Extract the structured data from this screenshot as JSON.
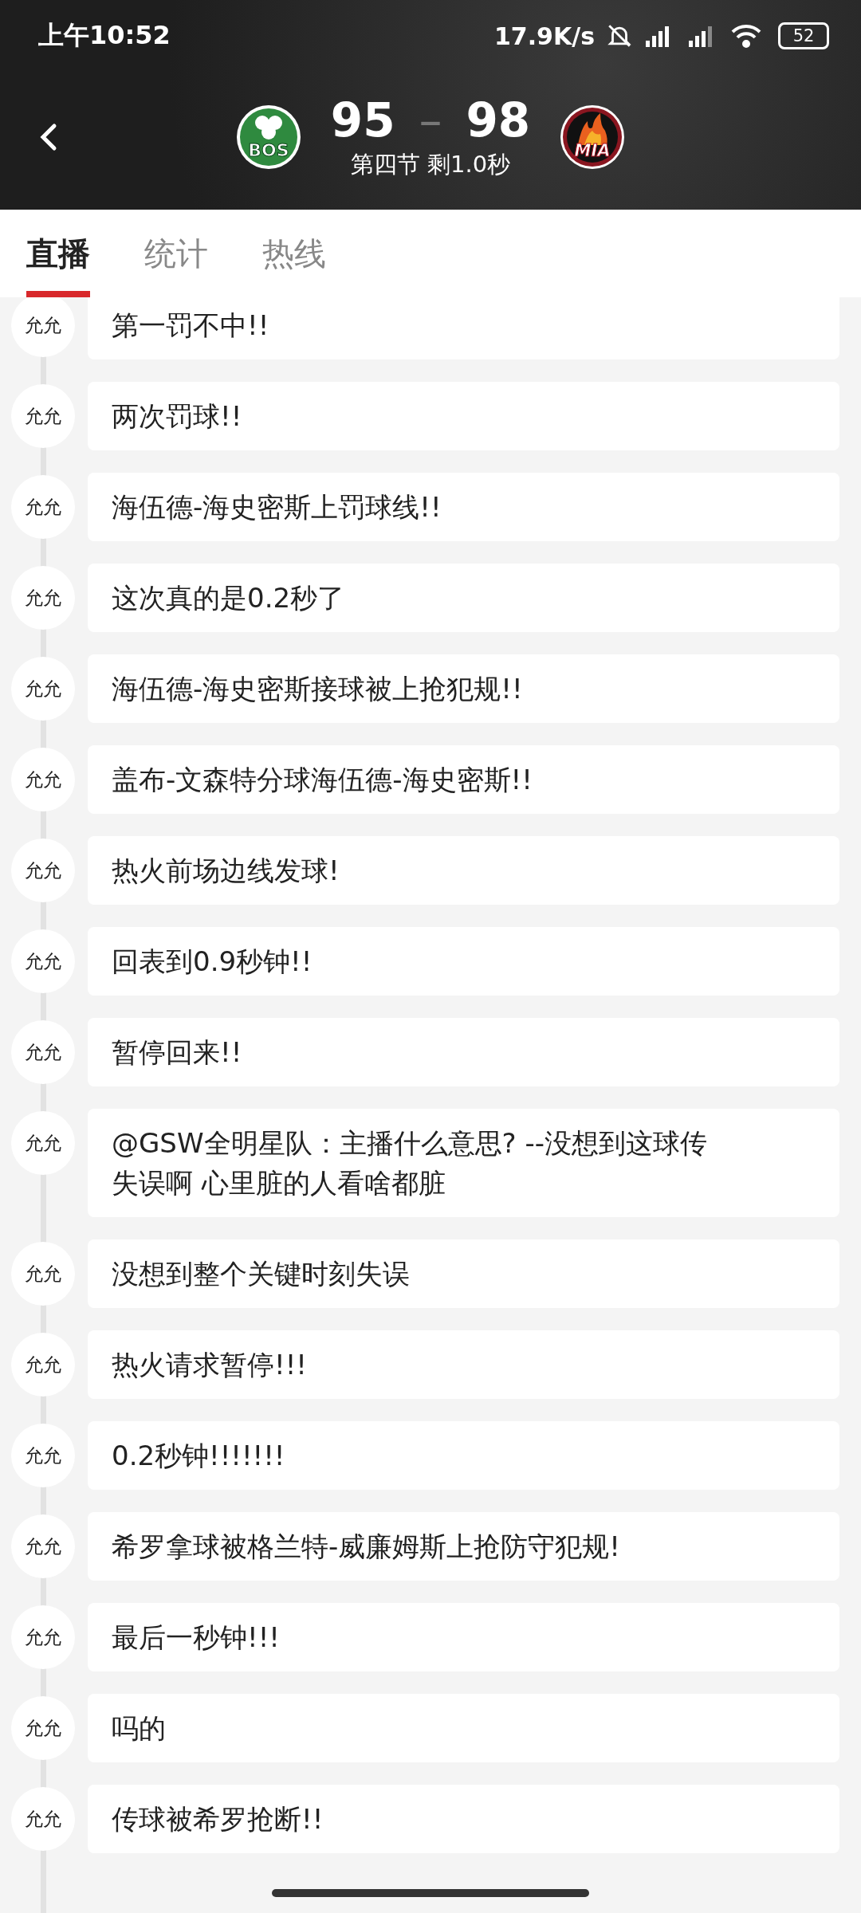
{
  "status_bar": {
    "time": "上午10:52",
    "net_speed": "17.9K/s",
    "battery": "52"
  },
  "header": {
    "home_team": {
      "logo_text": "BOS"
    },
    "home_score": "95",
    "separator": "–",
    "away_score": "98",
    "period": "第四节 剩1.0秒",
    "away_team": {
      "logo_text": "MIA"
    }
  },
  "tabs": [
    {
      "label": "直播",
      "selected": true
    },
    {
      "label": "统计",
      "selected": false
    },
    {
      "label": "热线",
      "selected": false
    }
  ],
  "feed": [
    {
      "author": "允允",
      "text": "第一罚不中!!"
    },
    {
      "author": "允允",
      "text": "两次罚球!!"
    },
    {
      "author": "允允",
      "text": "海伍德-海史密斯上罚球线!!"
    },
    {
      "author": "允允",
      "text": "这次真的是0.2秒了"
    },
    {
      "author": "允允",
      "text": "海伍德-海史密斯接球被上抢犯规!!"
    },
    {
      "author": "允允",
      "text": "盖布-文森特分球海伍德-海史密斯!!"
    },
    {
      "author": "允允",
      "text": "热火前场边线发球!"
    },
    {
      "author": "允允",
      "text": "回表到0.9秒钟!!"
    },
    {
      "author": "允允",
      "text": "暂停回来!!"
    },
    {
      "author": "允允",
      "text": "@GSW全明星队：主播什么意思? --没想到这球传失误啊 心里脏的人看啥都脏"
    },
    {
      "author": "允允",
      "text": "没想到整个关键时刻失误"
    },
    {
      "author": "允允",
      "text": "热火请求暂停!!!"
    },
    {
      "author": "允允",
      "text": "0.2秒钟!!!!!!!"
    },
    {
      "author": "允允",
      "text": "希罗拿球被格兰特-威廉姆斯上抢防守犯规!"
    },
    {
      "author": "允允",
      "text": "最后一秒钟!!!"
    },
    {
      "author": "允允",
      "text": "吗的"
    },
    {
      "author": "允允",
      "text": "传球被希罗抢断!!"
    }
  ]
}
